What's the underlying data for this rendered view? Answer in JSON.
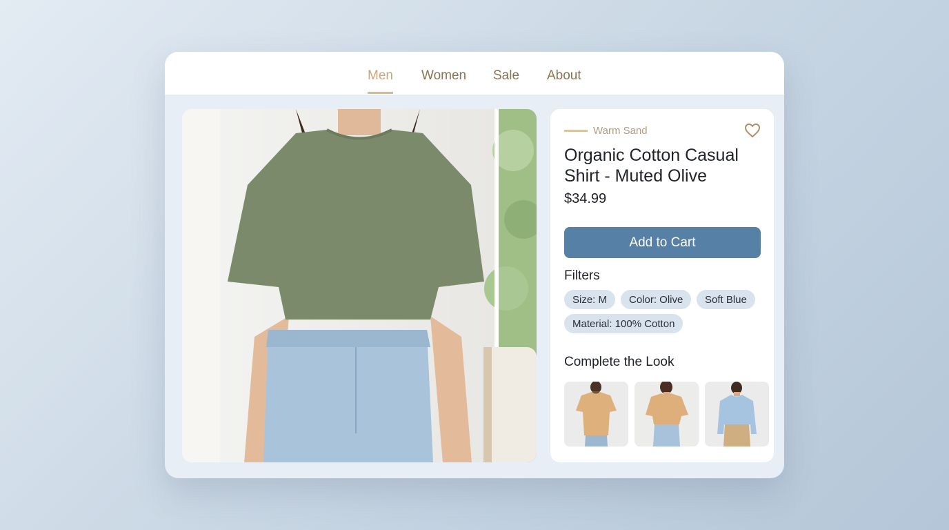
{
  "nav": {
    "items": [
      {
        "label": "Men",
        "active": true
      },
      {
        "label": "Women",
        "active": false
      },
      {
        "label": "Sale",
        "active": false
      },
      {
        "label": "About",
        "active": false
      }
    ]
  },
  "product": {
    "tag": "Warm Sand",
    "title": "Organic Cotton Casual Shirt - Muted Olive",
    "price": "$34.99",
    "add_to_cart_label": "Add to Cart"
  },
  "filters": {
    "heading": "Filters",
    "chips": [
      "Size: M",
      "Color: Olive",
      "Soft Blue",
      "Material: 100% Cotton"
    ]
  },
  "complete_the_look": {
    "heading": "Complete the Look",
    "items": [
      {
        "icon": "sand-tshirt-with-jeans"
      },
      {
        "icon": "sand-crop-tee-with-jeans"
      },
      {
        "icon": "soft-blue-sweatshirt-with-khaki-pants"
      }
    ]
  },
  "colors": {
    "accent": "#c9a77a",
    "button": "#5780a6",
    "chip": "#d8e3ee",
    "olive": "#7b8a6b",
    "denim": "#a9c3da"
  }
}
